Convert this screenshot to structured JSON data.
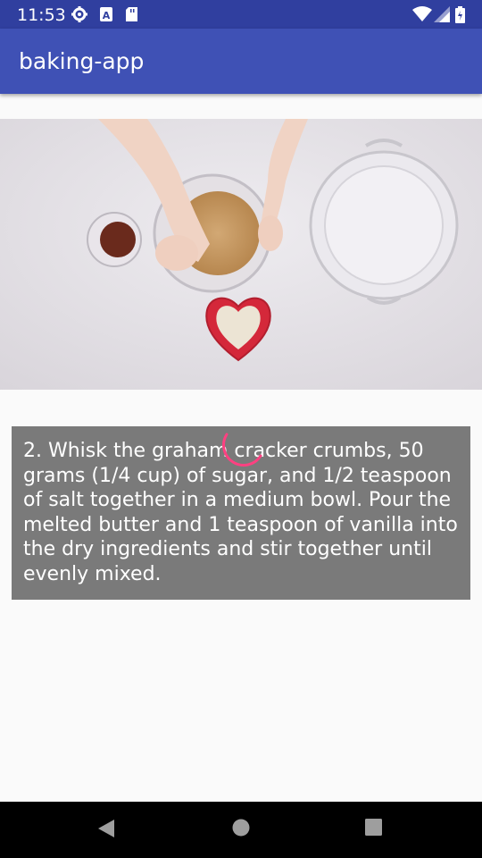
{
  "status_bar": {
    "time": "11:53",
    "icons": [
      "gear-icon",
      "a-notification-icon",
      "sd-card-icon",
      "wifi-icon",
      "battery-icon"
    ]
  },
  "app_bar": {
    "title": "baking-app"
  },
  "step": {
    "description": "2. Whisk the graham cracker crumbs, 50 grams (1/4 cup) of sugar, and 1/2 teaspoon of salt together in a medium bowl. Pour the melted butter and 1 teaspoon of vanilla into the dry ingredients and stir together until evenly mixed."
  },
  "nav_bar": {
    "buttons": [
      "back-icon",
      "home-icon",
      "recents-icon"
    ]
  },
  "colors": {
    "primary": "#3f51b5",
    "primary_dark": "#303f9f",
    "accent": "#ff4081",
    "card": "#7a7a7a"
  }
}
